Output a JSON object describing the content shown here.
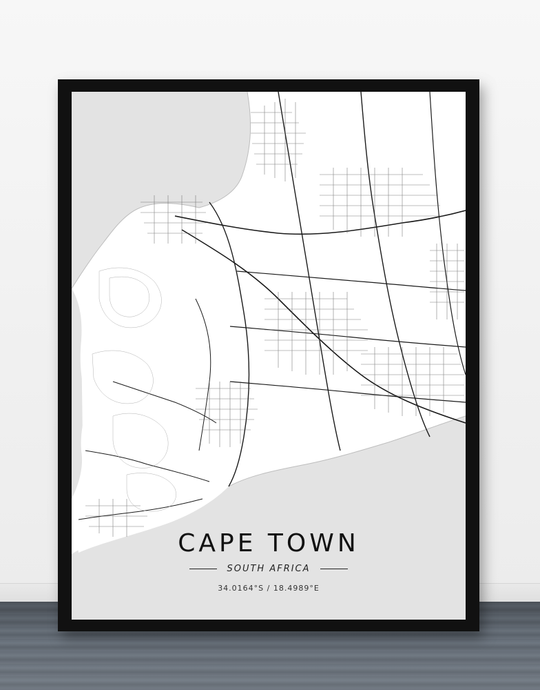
{
  "poster": {
    "city": "CAPE TOWN",
    "country": "SOUTH AFRICA",
    "coordinates": "34.0164°S / 18.4989°E"
  },
  "colors": {
    "water": "#e3e3e3",
    "land": "#ffffff",
    "roads": "#1a1a1a",
    "frame": "#111111"
  }
}
